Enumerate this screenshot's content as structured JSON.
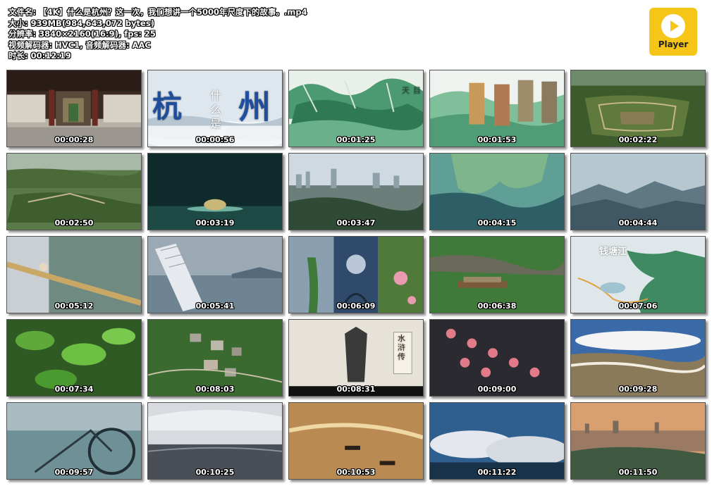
{
  "file_info": {
    "lines": [
      "文件名: 【4K】什么是杭州？这一次，我们想讲一个5000年尺度下的故事。.mp4",
      "大小: 939MB(984,643,072 bytes)",
      "分辨率: 3840×2160(16:9), fps: 25",
      "视频解码器: HVC1, 音频解码器: AAC",
      "时长: 00:12:19"
    ]
  },
  "player_logo": {
    "label": "Player",
    "color": "#f5c518"
  },
  "thumbnails": [
    {
      "time": "00:00:28"
    },
    {
      "time": "00:00:56",
      "title_chars": [
        "杭",
        "什",
        "么",
        "是",
        "州"
      ]
    },
    {
      "time": "00:01:25",
      "map_labels": [
        "天",
        "目"
      ]
    },
    {
      "time": "00:01:53"
    },
    {
      "time": "00:02:22"
    },
    {
      "time": "00:02:50"
    },
    {
      "time": "00:03:19"
    },
    {
      "time": "00:03:47"
    },
    {
      "time": "00:04:15"
    },
    {
      "time": "00:04:44"
    },
    {
      "time": "00:05:12"
    },
    {
      "time": "00:05:41"
    },
    {
      "time": "00:06:09"
    },
    {
      "time": "00:06:38"
    },
    {
      "time": "00:07:06",
      "map_label": "钱塘江"
    },
    {
      "time": "00:07:34"
    },
    {
      "time": "00:08:03"
    },
    {
      "time": "00:08:31",
      "side_label": "水浒传"
    },
    {
      "time": "00:09:00"
    },
    {
      "time": "00:09:28"
    },
    {
      "time": "00:09:57"
    },
    {
      "time": "00:10:25"
    },
    {
      "time": "00:10:53"
    },
    {
      "time": "00:11:22"
    },
    {
      "time": "00:11:50"
    }
  ]
}
